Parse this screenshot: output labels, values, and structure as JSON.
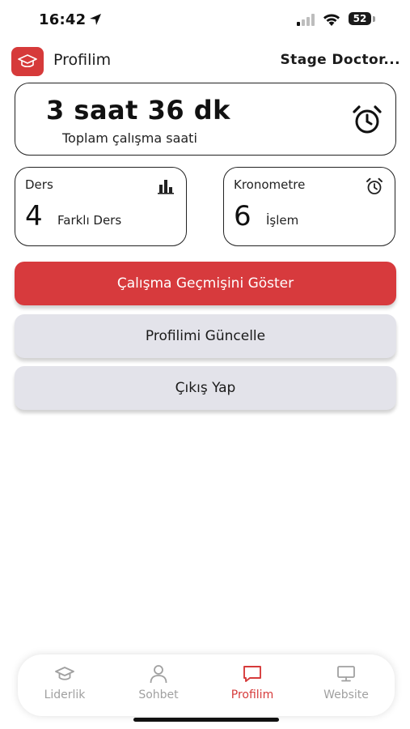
{
  "status_bar": {
    "time": "16:42",
    "battery_level": "52"
  },
  "header": {
    "title": "Profilim",
    "user_name": "Stage Doctor..."
  },
  "summary": {
    "total_time": "3 saat 36 dk",
    "total_label": "Toplam çalışma saati"
  },
  "stats": {
    "ders": {
      "title": "Ders",
      "value": "4",
      "label": "Farklı Ders"
    },
    "kronometre": {
      "title": "Kronometre",
      "value": "6",
      "label": "İşlem"
    }
  },
  "actions": {
    "history": "Çalışma Geçmişini Göster",
    "update_profile": "Profilimi Güncelle",
    "logout": "Çıkış Yap"
  },
  "nav": {
    "items": [
      {
        "label": "Liderlik",
        "icon": "graduation-cap-icon"
      },
      {
        "label": "Sohbet",
        "icon": "person-icon"
      },
      {
        "label": "Profilim",
        "icon": "chat-bubble-icon",
        "active": true
      },
      {
        "label": "Website",
        "icon": "monitor-icon"
      }
    ]
  },
  "colors": {
    "accent": "#d63a3a",
    "secondary_button": "#e3e3ea",
    "inactive_nav": "#a0a0a0"
  }
}
